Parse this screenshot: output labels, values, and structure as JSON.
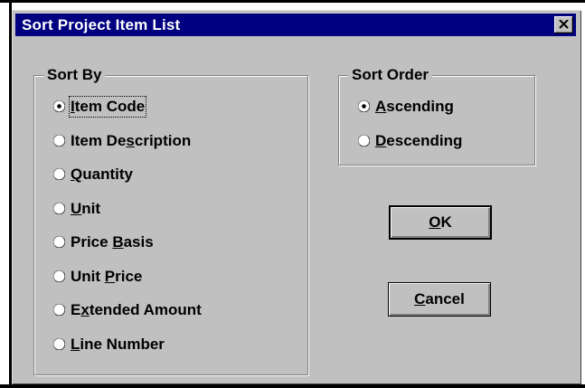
{
  "dialog": {
    "title": "Sort Project Item List",
    "close_label": "×"
  },
  "sort_by": {
    "legend": "Sort By",
    "options": [
      {
        "pre": "",
        "key": "I",
        "post": "tem Code",
        "selected": true
      },
      {
        "pre": "Item De",
        "key": "s",
        "post": "cription",
        "selected": false
      },
      {
        "pre": "",
        "key": "Q",
        "post": "uantity",
        "selected": false
      },
      {
        "pre": "",
        "key": "U",
        "post": "nit",
        "selected": false
      },
      {
        "pre": "Price ",
        "key": "B",
        "post": "asis",
        "selected": false
      },
      {
        "pre": "Unit ",
        "key": "P",
        "post": "rice",
        "selected": false
      },
      {
        "pre": "E",
        "key": "x",
        "post": "tended Amount",
        "selected": false
      },
      {
        "pre": "",
        "key": "L",
        "post": "ine Number",
        "selected": false
      }
    ]
  },
  "sort_order": {
    "legend": "Sort Order",
    "options": [
      {
        "pre": "",
        "key": "A",
        "post": "scending",
        "selected": true
      },
      {
        "pre": "",
        "key": "D",
        "post": "escending",
        "selected": false
      }
    ]
  },
  "buttons": {
    "ok": {
      "pre": "",
      "key": "O",
      "post": "K"
    },
    "cancel": {
      "pre": "",
      "key": "C",
      "post": "ancel"
    }
  }
}
